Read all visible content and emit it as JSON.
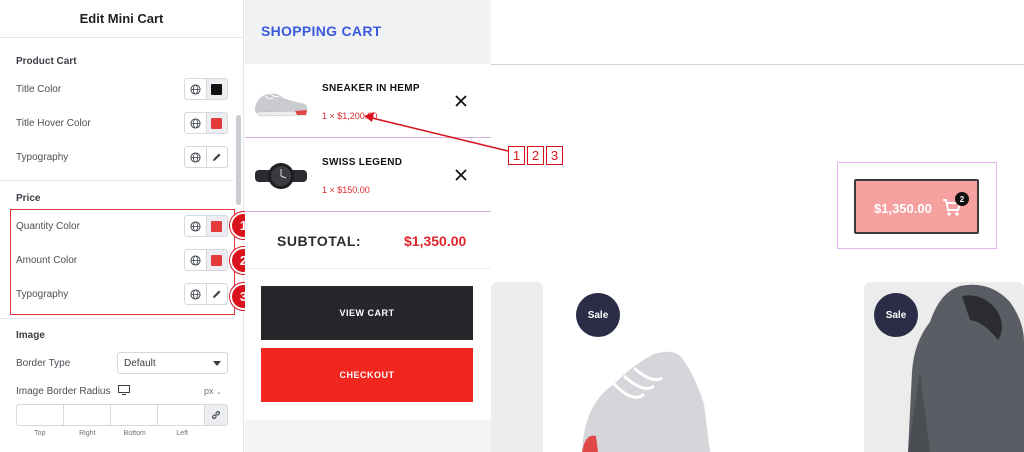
{
  "panel": {
    "title": "Edit Mini Cart",
    "product_cart": {
      "section_title": "Product Cart",
      "title_color_label": "Title Color",
      "title_hover_color_label": "Title Hover Color",
      "typography_label": "Typography"
    },
    "price": {
      "section_title": "Price",
      "quantity_color_label": "Quantity Color",
      "amount_color_label": "Amount Color",
      "typography_label": "Typography",
      "badges": [
        "1",
        "2",
        "3"
      ]
    },
    "image": {
      "section_title": "Image",
      "border_type_label": "Border Type",
      "border_type_value": "Default",
      "border_radius_label": "Image Border Radius",
      "unit": "px",
      "sides": [
        "Top",
        "Right",
        "Bottom",
        "Left"
      ]
    },
    "colors": {
      "title_swatch": "#111111",
      "hover_swatch": "#e23b3b",
      "quantity_swatch": "#e23b3b",
      "amount_swatch": "#e23b3b",
      "highlight": "#d9121e"
    }
  },
  "cart": {
    "title": "SHOPPING CART",
    "items": [
      {
        "name": "SNEAKER IN HEMP",
        "price": "1 × $1,200.00",
        "icon": "sneaker-image"
      },
      {
        "name": "SWISS LEGEND",
        "price": "1 × $150.00",
        "icon": "watch-image"
      }
    ],
    "subtotal_label": "SUBTOTAL:",
    "subtotal_value": "$1,350.00",
    "view_cart_label": "VIEW CART",
    "checkout_label": "CHECKOUT"
  },
  "annotation": {
    "steps": [
      "1",
      "2",
      "3"
    ]
  },
  "mini_cart": {
    "amount": "$1,350.00",
    "count": "2",
    "icon": "cart-icon"
  },
  "products": [
    {
      "badge": "Sale"
    },
    {
      "badge": "Sale"
    }
  ]
}
